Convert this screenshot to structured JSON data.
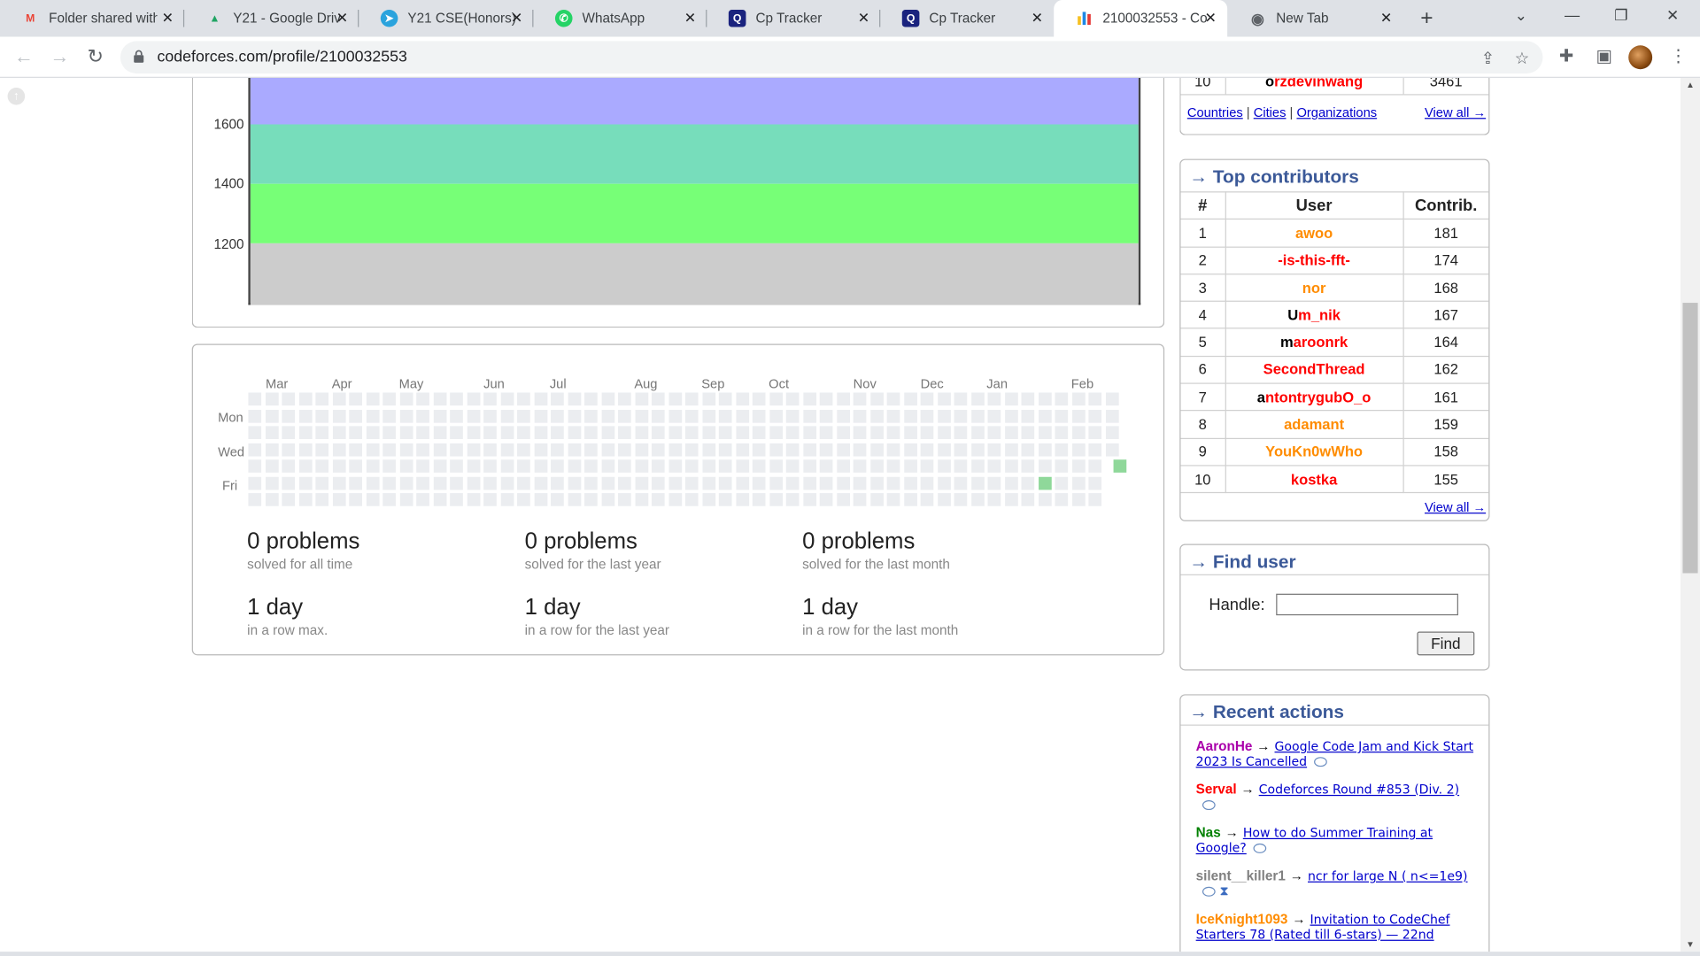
{
  "browser": {
    "tabs": [
      {
        "label": "Folder shared with",
        "icon": "M"
      },
      {
        "label": "Y21 - Google Driv",
        "icon": "▲"
      },
      {
        "label": "Y21 CSE(Honors)",
        "icon": "➤"
      },
      {
        "label": "WhatsApp",
        "icon": "✆"
      },
      {
        "label": "Cp Tracker",
        "icon": "Q"
      },
      {
        "label": "Cp Tracker",
        "icon": "Q"
      },
      {
        "label": "2100032553 - Co",
        "icon": "▮"
      },
      {
        "label": "New Tab",
        "icon": "◉"
      }
    ],
    "new_tab": "+",
    "url": "codeforces.com/profile/2100032553",
    "window_controls": {
      "chevron": "⌄",
      "minimize": "—",
      "restore": "❐",
      "close": "✕"
    }
  },
  "graph": {
    "y_ticks": [
      "1600",
      "1400",
      "1200"
    ],
    "band_colors": [
      "#aaaaff",
      "#77ddbb",
      "#77ff77",
      "#cccccc"
    ]
  },
  "activity": {
    "months": [
      "Mar",
      "Apr",
      "May",
      "Jun",
      "Jul",
      "Aug",
      "Sep",
      "Oct",
      "Nov",
      "Dec",
      "Jan",
      "Feb"
    ],
    "days": [
      "Mon",
      "Wed",
      "Fri"
    ],
    "stats": [
      {
        "big": "0 problems",
        "small": "solved for all time"
      },
      {
        "big": "0 problems",
        "small": "solved for the last year"
      },
      {
        "big": "0 problems",
        "small": "solved for the last month"
      },
      {
        "big": "1 day",
        "small": "in a row max."
      },
      {
        "big": "1 day",
        "small": "in a row for the last year"
      },
      {
        "big": "1 day",
        "small": "in a row for the last month"
      }
    ]
  },
  "top_rated_tail": {
    "rank": "10",
    "user_first": "o",
    "user_rest": "rzdevinwang",
    "rating": "3461",
    "links": [
      "Countries",
      "Cities",
      "Organizations"
    ],
    "view_all": "View all →"
  },
  "top_contributors": {
    "title": "→ Top contributors",
    "headers": [
      "#",
      "User",
      "Contrib."
    ],
    "rows": [
      {
        "rank": "1",
        "user": "awoo",
        "contrib": "181"
      },
      {
        "rank": "2",
        "user": "-is-this-fft-",
        "contrib": "174"
      },
      {
        "rank": "3",
        "user": "nor",
        "contrib": "168"
      },
      {
        "rank": "4",
        "user": "Um_nik",
        "contrib": "167"
      },
      {
        "rank": "5",
        "user": "maroonrk",
        "contrib": "164"
      },
      {
        "rank": "6",
        "user": "SecondThread",
        "contrib": "162"
      },
      {
        "rank": "7",
        "user": "antontrygubO_o",
        "contrib": "161"
      },
      {
        "rank": "8",
        "user": "adamant",
        "contrib": "159"
      },
      {
        "rank": "9",
        "user": "YouKn0wWho",
        "contrib": "158"
      },
      {
        "rank": "10",
        "user": "kostka",
        "contrib": "155"
      }
    ],
    "view_all": "View all →"
  },
  "find_user": {
    "title": "→ Find user",
    "handle_label": "Handle:",
    "handle_value": "",
    "button": "Find"
  },
  "recent_actions": {
    "title": "→ Recent actions",
    "items": [
      {
        "user": "AaronHe",
        "arrow": "→",
        "text": "Google Code Jam and Kick Start 2023 Is Cancelled"
      },
      {
        "user": "Serval",
        "arrow": "→",
        "text": "Codeforces Round #853 (Div. 2)"
      },
      {
        "user": "Nas",
        "arrow": "→",
        "text": "How to do Summer Training at Google?"
      },
      {
        "user": "silent__killer1",
        "arrow": "→",
        "text": "ncr for large N ( n<=1e9)"
      },
      {
        "user": "IceKnight1093",
        "arrow": "→",
        "text": "Invitation to CodeChef Starters 78 (Rated till 6-stars) — 22nd"
      }
    ],
    "colors": {
      "AaronHe": "#aa00aa",
      "Serval": "#ff0000",
      "Nas": "#008000",
      "silent__killer1": "#808080",
      "IceKnight1093": "#ff8c00"
    }
  }
}
